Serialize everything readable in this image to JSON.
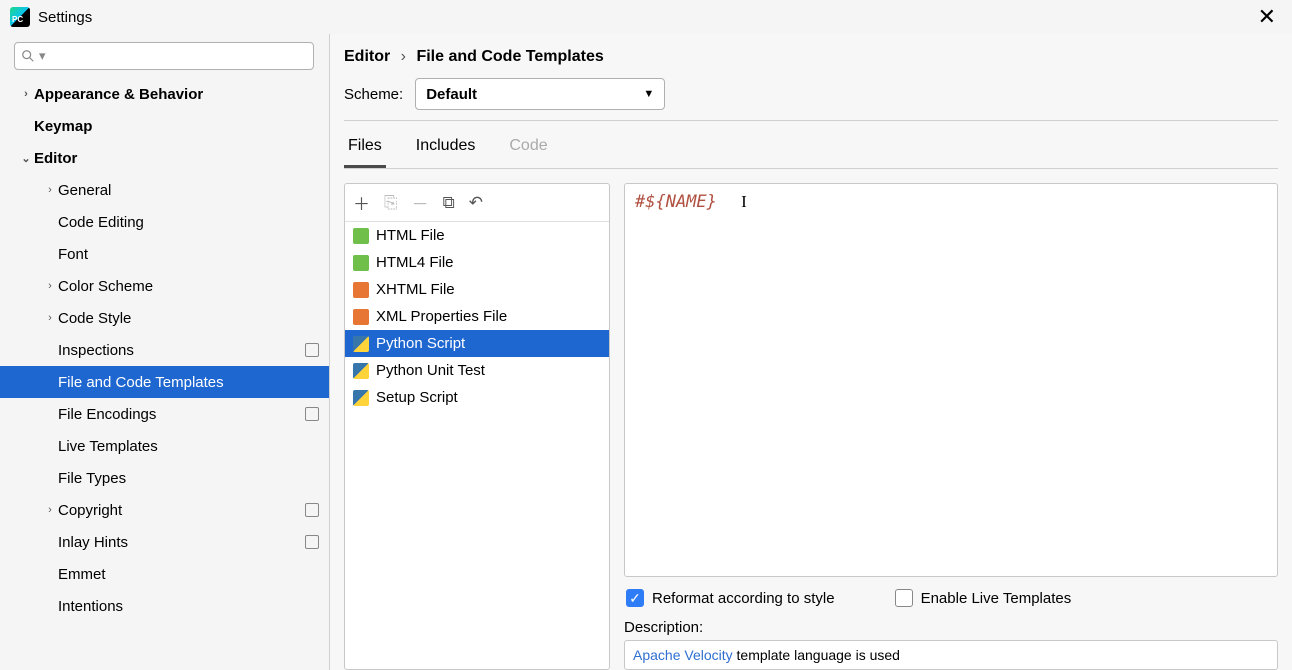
{
  "window": {
    "title": "Settings"
  },
  "search": {
    "placeholder": ""
  },
  "sidebar": {
    "items": [
      {
        "label": "Appearance & Behavior",
        "indent": 18,
        "chev": "›",
        "bold": true
      },
      {
        "label": "Keymap",
        "indent": 34,
        "bold": true
      },
      {
        "label": "Editor",
        "indent": 18,
        "chev": "⌄",
        "bold": true
      },
      {
        "label": "General",
        "indent": 42,
        "chev": "›"
      },
      {
        "label": "Code Editing",
        "indent": 58
      },
      {
        "label": "Font",
        "indent": 58
      },
      {
        "label": "Color Scheme",
        "indent": 42,
        "chev": "›"
      },
      {
        "label": "Code Style",
        "indent": 42,
        "chev": "›"
      },
      {
        "label": "Inspections",
        "indent": 58,
        "badge": true
      },
      {
        "label": "File and Code Templates",
        "indent": 58,
        "selected": true
      },
      {
        "label": "File Encodings",
        "indent": 58,
        "badge": true
      },
      {
        "label": "Live Templates",
        "indent": 58
      },
      {
        "label": "File Types",
        "indent": 58
      },
      {
        "label": "Copyright",
        "indent": 42,
        "chev": "›",
        "badge": true
      },
      {
        "label": "Inlay Hints",
        "indent": 58,
        "badge": true
      },
      {
        "label": "Emmet",
        "indent": 58
      },
      {
        "label": "Intentions",
        "indent": 58
      }
    ]
  },
  "breadcrumb": {
    "first": "Editor",
    "second": "File and Code Templates"
  },
  "scheme": {
    "label": "Scheme:",
    "value": "Default"
  },
  "tabs": [
    {
      "label": "Files",
      "state": "active"
    },
    {
      "label": "Includes",
      "state": ""
    },
    {
      "label": "Code",
      "state": "disabled"
    }
  ],
  "templates": [
    {
      "label": "HTML File",
      "icon": "green"
    },
    {
      "label": "HTML4 File",
      "icon": "green"
    },
    {
      "label": "XHTML File",
      "icon": "orange"
    },
    {
      "label": "XML Properties File",
      "icon": "orange"
    },
    {
      "label": "Python Script",
      "icon": "py",
      "selected": true
    },
    {
      "label": "Python Unit Test",
      "icon": "py"
    },
    {
      "label": "Setup Script",
      "icon": "py"
    }
  ],
  "editor": {
    "content": "#${NAME}"
  },
  "checks": {
    "reformat": {
      "label": "Reformat according to style",
      "checked": true
    },
    "live": {
      "label": "Enable Live Templates",
      "checked": false
    }
  },
  "description": {
    "label": "Description:",
    "link": "Apache Velocity",
    "text": " template language is used"
  }
}
